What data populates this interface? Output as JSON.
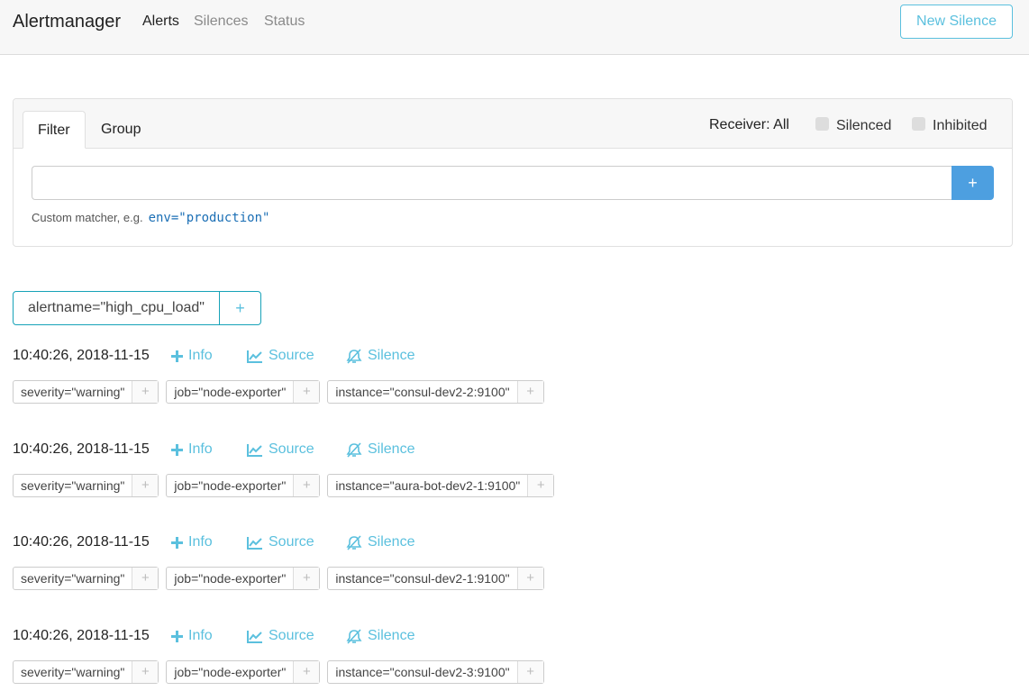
{
  "navbar": {
    "brand": "Alertmanager",
    "links": [
      {
        "label": "Alerts"
      },
      {
        "label": "Silences"
      },
      {
        "label": "Status"
      }
    ],
    "new_silence": "New Silence"
  },
  "filter_panel": {
    "tabs": [
      {
        "label": "Filter"
      },
      {
        "label": "Group"
      }
    ],
    "receiver": "Receiver: All",
    "silenced": "Silenced",
    "inhibited": "Inhibited",
    "input_value": "",
    "add": "+",
    "hint": "Custom matcher, e.g.",
    "hint_example": "env=\"production\""
  },
  "group": {
    "label": "alertname=\"high_cpu_load\"",
    "add": "+"
  },
  "actions": {
    "info": "Info",
    "source": "Source",
    "silence": "Silence"
  },
  "alerts": [
    {
      "time": "10:40:26, 2018-11-15",
      "labels": [
        "severity=\"warning\"",
        "job=\"node-exporter\"",
        "instance=\"consul-dev2-2:9100\""
      ]
    },
    {
      "time": "10:40:26, 2018-11-15",
      "labels": [
        "severity=\"warning\"",
        "job=\"node-exporter\"",
        "instance=\"aura-bot-dev2-1:9100\""
      ]
    },
    {
      "time": "10:40:26, 2018-11-15",
      "labels": [
        "severity=\"warning\"",
        "job=\"node-exporter\"",
        "instance=\"consul-dev2-1:9100\""
      ]
    },
    {
      "time": "10:40:26, 2018-11-15",
      "labels": [
        "severity=\"warning\"",
        "job=\"node-exporter\"",
        "instance=\"consul-dev2-3:9100\""
      ]
    }
  ],
  "label_add": "+",
  "colors": {
    "accent": "#5bc0de",
    "primary_button": "#4d9fe0",
    "group_border": "#17a2b8"
  }
}
